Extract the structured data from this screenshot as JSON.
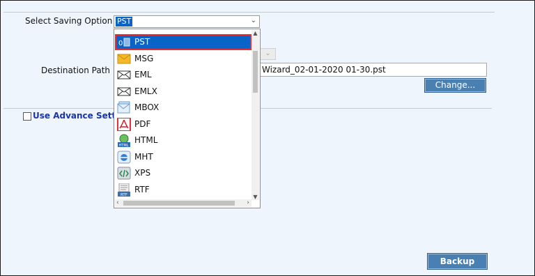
{
  "form": {
    "saving_label": "Select Saving Option :",
    "selected_value": "PST",
    "destination_label": "Destination Path :",
    "destination_value": "Wizard_02-01-2020 01-30.pst",
    "change_button": "Change...",
    "advance_settings_label": "Use Advance Settings",
    "advance_settings_checked": false,
    "backup_button": "Backup"
  },
  "dropdown": {
    "selected_index": 0,
    "items": [
      {
        "label": "PST",
        "icon": "pst-icon"
      },
      {
        "label": "MSG",
        "icon": "msg-envelope-icon"
      },
      {
        "label": "EML",
        "icon": "eml-envelope-icon"
      },
      {
        "label": "EMLX",
        "icon": "emlx-envelope-icon"
      },
      {
        "label": "MBOX",
        "icon": "mbox-icon"
      },
      {
        "label": "PDF",
        "icon": "pdf-icon"
      },
      {
        "label": "HTML",
        "icon": "html-icon"
      },
      {
        "label": "MHT",
        "icon": "mht-icon"
      },
      {
        "label": "XPS",
        "icon": "xps-icon"
      },
      {
        "label": "RTF",
        "icon": "rtf-icon"
      }
    ]
  },
  "colors": {
    "accent": "#0a64c8",
    "highlight_box": "#e0303a",
    "button": "#4a7fb2",
    "background": "#eef5fd",
    "link": "#1a35a8"
  }
}
